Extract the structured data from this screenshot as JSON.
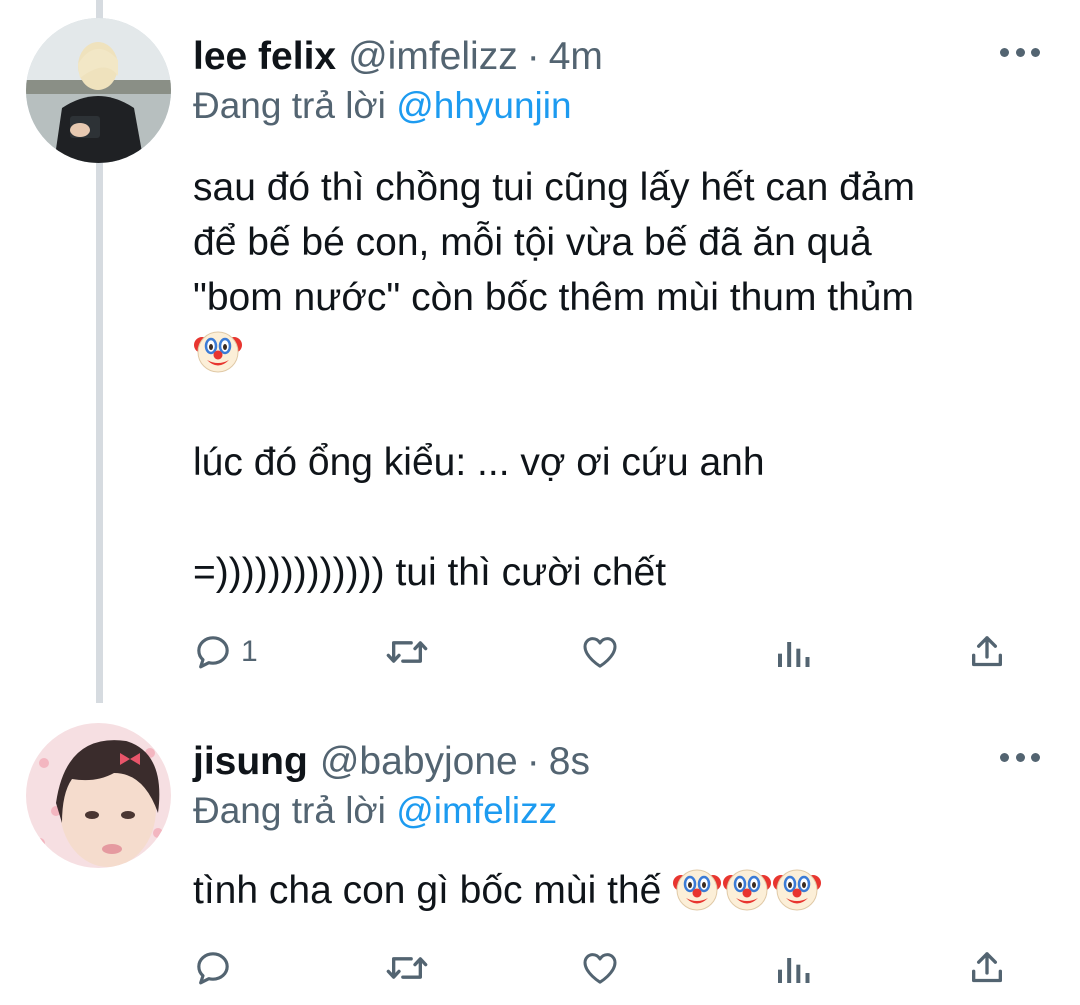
{
  "tweets": [
    {
      "name": "lee felix",
      "handle": "@imfelizz",
      "separator": "·",
      "time": "4m",
      "reply_prefix": "Đang trả lời",
      "reply_to": "@hhyunjin",
      "lines": [
        "sau đó thì chồng tui cũng lấy hết can đảm",
        "để bế bé con, mỗi tội vừa bế đã ăn quả",
        "\"bom nước\" còn bốc thêm mùi thum thủm",
        "",
        "",
        "lúc đó ổng kiểu: ... vợ ơi cứu anh",
        "",
        "=))))))))))))) tui thì cười chết"
      ],
      "emoji_line_icon": "clown-face-emoji",
      "reply_count": "1",
      "icons": [
        "reply-icon",
        "retweet-icon",
        "like-icon",
        "views-icon",
        "share-icon",
        "more-icon"
      ]
    },
    {
      "name": "jisung",
      "handle": "@babyjone",
      "separator": "·",
      "time": "8s",
      "reply_prefix": "Đang trả lời",
      "reply_to": "@imfelizz",
      "text": "tình cha con gì bốc mùi thế",
      "emoji_count": 3,
      "emoji_icon": "clown-face-emoji",
      "reply_count": "",
      "icons": [
        "reply-icon",
        "retweet-icon",
        "like-icon",
        "views-icon",
        "share-icon",
        "more-icon"
      ]
    }
  ],
  "colors": {
    "text": "#0f1419",
    "secondary": "#536471",
    "accent": "#1d9bf0",
    "thread_line": "#d6dbe0",
    "background": "#ffffff"
  }
}
